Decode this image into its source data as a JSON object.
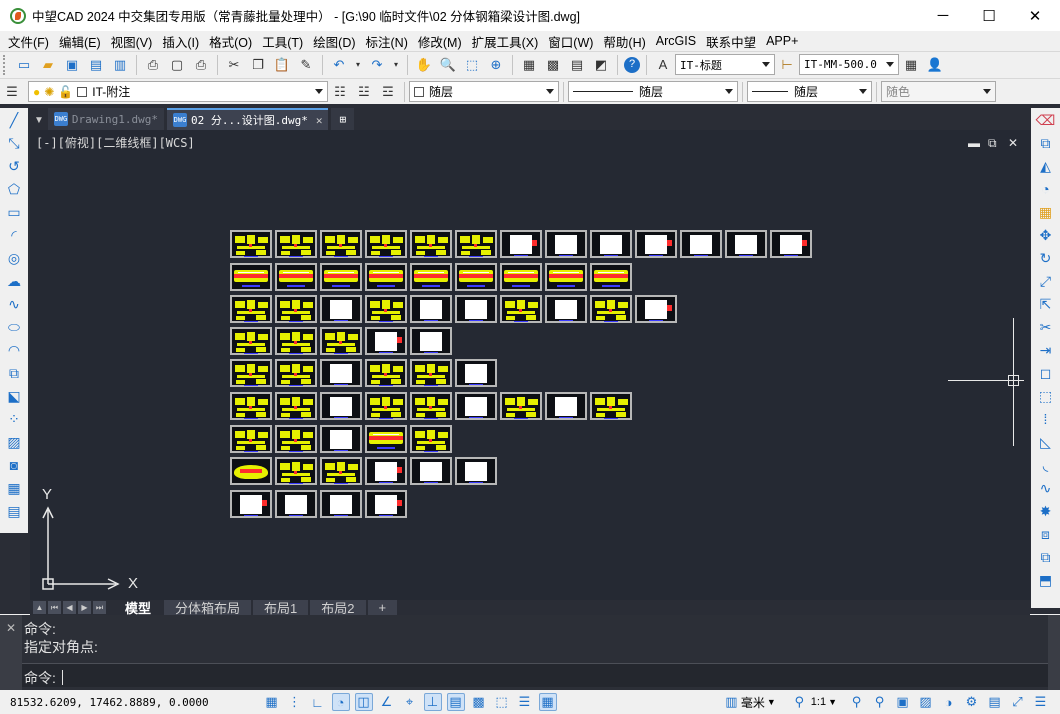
{
  "window": {
    "title": "中望CAD 2024 中交集团专用版（常青藤批量处理中）  - [G:\\90 临时文件\\02 分体钢箱梁设计图.dwg]",
    "minimize_glyph": "─",
    "maximize_glyph": "☐",
    "close_glyph": "✕"
  },
  "menu": [
    "文件(F)",
    "编辑(E)",
    "视图(V)",
    "插入(I)",
    "格式(O)",
    "工具(T)",
    "绘图(D)",
    "标注(N)",
    "修改(M)",
    "扩展工具(X)",
    "窗口(W)",
    "帮助(H)",
    "ArcGIS",
    "联系中望",
    "APP+"
  ],
  "toolbar1": {
    "icons": [
      "new-icon",
      "open-icon",
      "save-icon",
      "save-as-icon",
      "batch-icon",
      "print-icon",
      "preview-icon",
      "plot-icon",
      "cut-icon",
      "copy-icon",
      "paste-icon",
      "match-properties-icon",
      "undo-icon",
      "redo-icon",
      "pan-icon",
      "zoom-realtime-icon",
      "zoom-window-icon",
      "zoom-previous-icon",
      "properties-icon",
      "design-center-icon",
      "tool-palette-icon",
      "sheet-set-icon",
      "help-icon"
    ],
    "text_style": "IT-标题",
    "dim_style": "IT-MM-500.0"
  },
  "toolbar2": {
    "layer": "IT-附注",
    "color": "随层",
    "linetype": "随层",
    "lineweight": "随层",
    "plotstyle": "随色"
  },
  "doc_tabs": [
    {
      "label": "Drawing1.dwg*",
      "active": false
    },
    {
      "label": "02 分...设计图.dwg*",
      "active": true
    }
  ],
  "doc_tab_icon_text": "DWG",
  "viewport_label": "[-][俯视][二维线框][WCS]",
  "ucs": {
    "x_label": "X",
    "y_label": "Y"
  },
  "layout_tabs": [
    "模型",
    "分体箱布局",
    "布局1",
    "布局2",
    "+"
  ],
  "command": {
    "history": [
      "命令:",
      "指定对角点:"
    ],
    "prompt": "命令:"
  },
  "status": {
    "coordinates": "81532.6209, 17462.8889, 0.0000",
    "units": "毫米",
    "scale": "1:1"
  },
  "colors": {
    "workspace_bg": "#252933",
    "drawing_yellow": "#e6f000",
    "drawing_red": "#ff2d2d",
    "drawing_blue": "#3a3aff",
    "accent": "#1d6fc7"
  }
}
